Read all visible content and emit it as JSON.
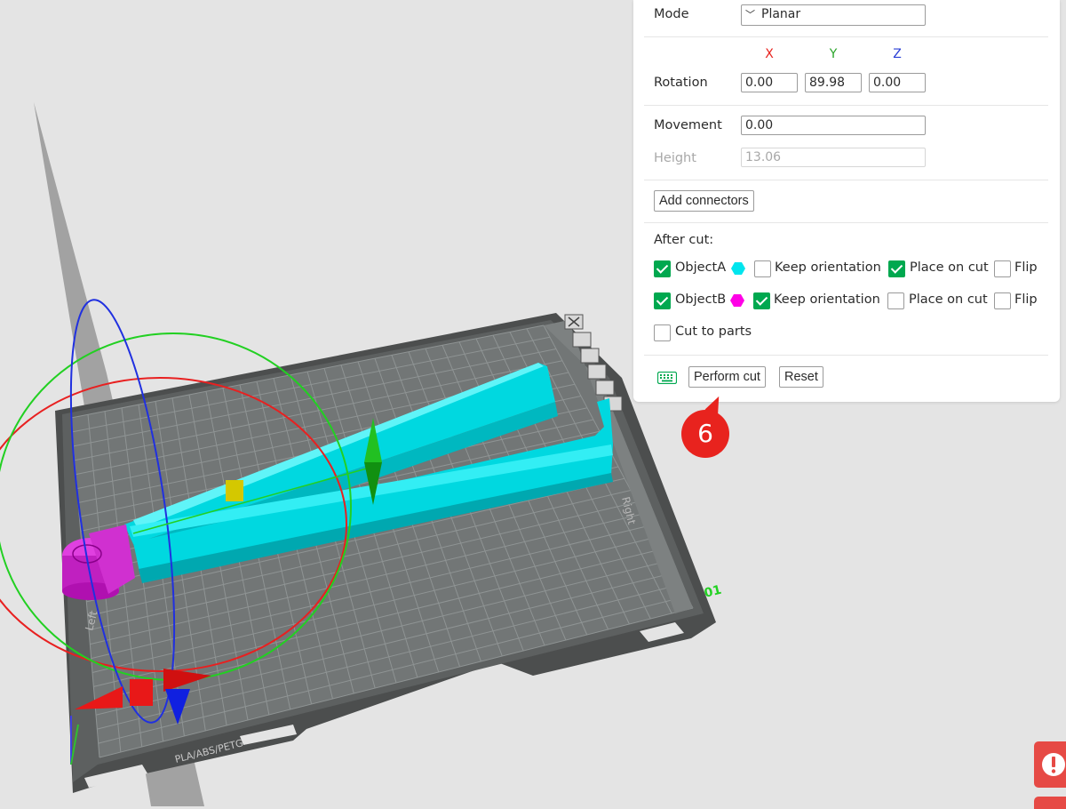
{
  "cut_panel": {
    "mode": {
      "label": "Mode",
      "value": "Planar",
      "chevron_icon": "chevron-down-icon"
    },
    "axes": {
      "x": "X",
      "y": "Y",
      "z": "Z",
      "x_color": "#e8231e",
      "y_color": "#2aa52a",
      "z_color": "#2a3fd6"
    },
    "rotation": {
      "label": "Rotation",
      "x": "0.00",
      "y": "89.98",
      "z": "0.00"
    },
    "movement": {
      "label": "Movement",
      "value": "0.00"
    },
    "height": {
      "label": "Height",
      "value": "13.06"
    },
    "add_connectors_label": "Add connectors",
    "after_cut": {
      "label": "After cut:",
      "object_a": {
        "label": "ObjectA",
        "checked": true,
        "color": "#00e5ee",
        "keep_orientation_label": "Keep orientation",
        "keep_orientation": false,
        "place_on_cut_label": "Place on cut",
        "place_on_cut": true,
        "flip_label": "Flip",
        "flip": false
      },
      "object_b": {
        "label": "ObjectB",
        "checked": true,
        "color": "#ff00e6",
        "keep_orientation_label": "Keep orientation",
        "keep_orientation": true,
        "place_on_cut_label": "Place on cut",
        "place_on_cut": false,
        "flip_label": "Flip",
        "flip": false
      },
      "cut_to_parts": {
        "label": "Cut to parts",
        "checked": false
      }
    },
    "keyboard_icon": "keyboard-icon",
    "perform_cut_label": "Perform cut",
    "reset_label": "Reset"
  },
  "callout": {
    "number": "6",
    "color": "#e8231e"
  },
  "viewport": {
    "bed_label": "PLA/ABS/PETG",
    "bed_corner_number": "01",
    "bed_side_text_left": "Left",
    "bed_side_text_right": "Right",
    "object_a_color": "#00e5ee",
    "object_b_color": "#e030e0",
    "toolbar_icons": [
      "close-icon",
      "layers-icon",
      "grid-icon",
      "printer-icon",
      "settings-icon",
      "collapse-icon"
    ]
  },
  "notification_icon": "warning-icon"
}
